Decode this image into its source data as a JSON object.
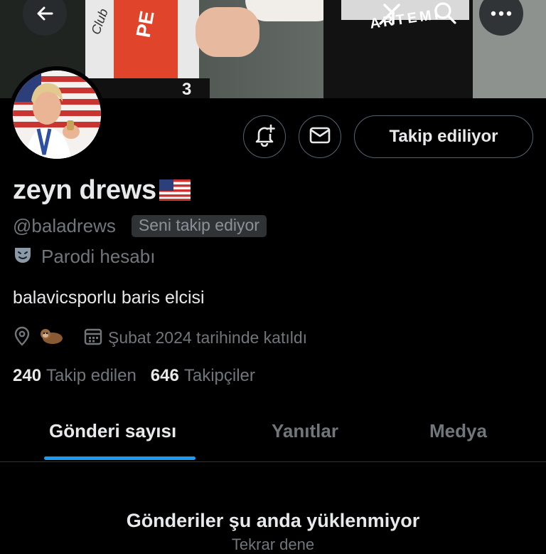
{
  "header": {
    "back_icon": "arrow-left-icon",
    "grok_icon": "grok-icon",
    "search_icon": "search-icon",
    "more_icon": "more-dots-icon"
  },
  "banner": {
    "jersey_text_1": "PE",
    "jersey_text_2": "3",
    "jersey_text_3": "ARTEMI",
    "jersey_text_4": "Club"
  },
  "profile": {
    "display_name": "zeyn drews",
    "handle": "@baladrews",
    "follows_you_badge": "Seni takip ediyor",
    "parody_label": "Parodi hesabı",
    "bio": "balavicsporlu baris elcisi",
    "joined": "Şubat 2024 tarihinde katıldı",
    "following_count": "240",
    "following_label": "Takip edilen",
    "followers_count": "646",
    "followers_label": "Takipçiler"
  },
  "actions": {
    "notify_icon": "bell-plus-icon",
    "message_icon": "envelope-icon",
    "follow_label": "Takip ediliyor"
  },
  "tabs": [
    {
      "label": "Gönderi sayısı",
      "active": true
    },
    {
      "label": "Yanıtlar",
      "active": false
    },
    {
      "label": "Medya",
      "active": false
    }
  ],
  "feed": {
    "empty_title": "Gönderiler şu anda yüklenmiyor",
    "retry_label": "Tekrar dene"
  },
  "colors": {
    "background": "#000000",
    "primary_text": "#e7e9ea",
    "secondary_text": "#71767b",
    "accent": "#1d9bf0",
    "border": "#2f3336"
  }
}
